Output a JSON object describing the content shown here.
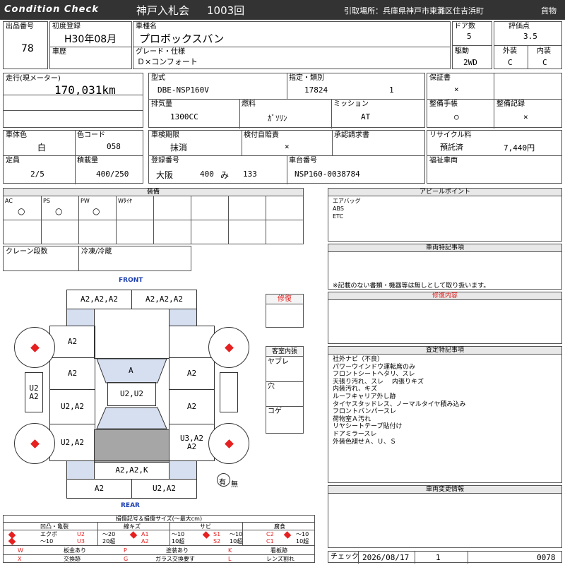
{
  "header": {
    "brand": "Condition Check",
    "auction": "神戸入札会",
    "lot": "1003回",
    "pickup": "引取場所：兵庫県神戸市東灘区住吉浜町",
    "category": "貨物"
  },
  "vehicle": {
    "lot_no_label": "出品番号",
    "lot_no": "78",
    "first_reg_label": "初度登録",
    "first_reg": "H30年08月",
    "name_label": "車種名",
    "name": "プロボックスバン",
    "doors_label": "ドア数",
    "doors": "5",
    "score_label": "評価点",
    "score": "3.5",
    "history_label": "車歴",
    "grade_label": "グレード・仕様",
    "grade": "Ｄ×コンフォート",
    "drive_label": "駆動",
    "drive": "2WD",
    "exterior_label": "外装",
    "exterior": "C",
    "interior_label": "内装",
    "interior": "C",
    "mileage_label": "走行(現メーター)",
    "mileage": "170,031km",
    "model_label": "型式",
    "model": "DBE-NSP160V",
    "designation_label": "指定・類別",
    "designation": "17824",
    "classification": "1",
    "warranty_label": "保証書",
    "warranty": "×",
    "displacement_label": "排気量",
    "displacement": "1300CC",
    "fuel_label": "燃料",
    "fuel": "ｶﾞｿﾘﾝ",
    "mission_label": "ミッション",
    "mission": "AT",
    "maint_label": "整備手帳",
    "maint": "○",
    "maint_rec_label": "整備記録",
    "maint_rec": "×",
    "color_label": "車体色",
    "color": "白",
    "color_code_label": "色コード",
    "color_code": "058",
    "inspection_label": "車検期限",
    "inspection": "抹消",
    "tax_label": "検付自賠責",
    "tax": "×",
    "approval_label": "承認請求書",
    "recycle_label": "リサイクル料",
    "recycle_status": "預託済",
    "recycle_amount": "7,440円",
    "capacity_label": "定員",
    "capacity": "2/5",
    "load_label": "積載量",
    "load": "400/250",
    "reg_no_label": "登録番号",
    "reg_area": "大阪",
    "reg_class": "400",
    "reg_kana": "み",
    "reg_num": "133",
    "chassis_label": "車台番号",
    "chassis": "NSP160-0038784",
    "welfare_label": "福祉車両"
  },
  "equipment": {
    "title": "装備",
    "items": [
      {
        "name": "AC",
        "value": "○"
      },
      {
        "name": "PS",
        "value": "○"
      },
      {
        "name": "PW",
        "value": "○"
      },
      {
        "name": "Wﾀｲﾔ",
        "value": ""
      }
    ],
    "crane_label": "クレーン段数",
    "freezer_label": "冷凍/冷蔵"
  },
  "diagram": {
    "front": "FRONT",
    "rear": "REAR",
    "front_left": "A2,A2,A2",
    "front_right": "A2,A2,A2",
    "left_front": "A2",
    "left_door1": "A2",
    "left_door2": "U2,A2",
    "left_rear": "U2,A2",
    "windshield": "A",
    "roof": "U2,U2",
    "right_door1": "A2",
    "right_door2": "A2",
    "right_rear": "U3,A2\nA2",
    "left_side": "U2\nA2",
    "rear_center": "A2,A2,K",
    "rear_left": "A2",
    "rear_right": "U2,A2",
    "spare_yes": "有",
    "spare_no": "無"
  },
  "repair": {
    "title": "修復"
  },
  "cabin": {
    "title": "客室内張",
    "rows": [
      "ヤブレ",
      "穴",
      "コゲ"
    ]
  },
  "appeal": {
    "title": "アピールポイント",
    "lines": [
      "エアバッグ",
      "ABS",
      "ETC"
    ]
  },
  "vehicle_notes": {
    "title": "車両特記事項",
    "note": "※記載のない書類・機器等は無しとして取り扱います。"
  },
  "repair_content": {
    "title": "修復内容"
  },
  "inspection_notes": {
    "title": "査定特記事項",
    "lines": [
      "社外ナビ（不良）",
      "パワーウインドウ運転席のみ",
      "フロントシートヘタリ、スレ",
      "天張り汚れ、スレ　 内張りキズ",
      "内装汚れ、キズ",
      "ルーフキャリア外し跡",
      "タイヤスタッドレス、ノーマルタイヤ積み込み",
      "フロントバンパースレ",
      "荷物室Ａ汚れ",
      "リヤシートテープ貼付け",
      "ドアミラースレ",
      "外装色褪せＡ、Ｕ、Ｓ"
    ]
  },
  "change_info": {
    "title": "車両変更情報"
  },
  "footer": {
    "check_label": "チェック",
    "date": "2026/08/17",
    "num": "1",
    "code": "0078"
  },
  "legend": {
    "title": "損傷記号＆損傷サイズ(〜最大cm)",
    "groups": [
      {
        "name": "凹凸・亀裂",
        "a": "エクボ",
        "b": "U2",
        "c": "〜20",
        "d": "U3",
        "e": "20超",
        "f": "〜10"
      },
      {
        "name": "線キズ",
        "a": "A1",
        "b": "〜10",
        "c": "A2",
        "d": "10超"
      },
      {
        "name": "サビ",
        "a": "S1",
        "b": "〜10",
        "c": "S2",
        "d": "10超"
      },
      {
        "name": "腐食",
        "a": "C1",
        "b": "〜10",
        "c": "C2",
        "d": "10超"
      }
    ],
    "rows": [
      {
        "k1": "W",
        "v1": "板金あり",
        "k2": "P",
        "v2": "塗装あり",
        "k3": "K",
        "v3": "看板跡"
      },
      {
        "k1": "X",
        "v1": "交換跡",
        "k2": "G",
        "v2": "ガラス交換要す",
        "k3": "L",
        "v3": "レンズ割れ"
      }
    ]
  },
  "colors": {
    "red": "#e62020",
    "blue": "#1c3fb0",
    "panel_blue": "#d6dff0",
    "gray": "#a6a6a6"
  }
}
